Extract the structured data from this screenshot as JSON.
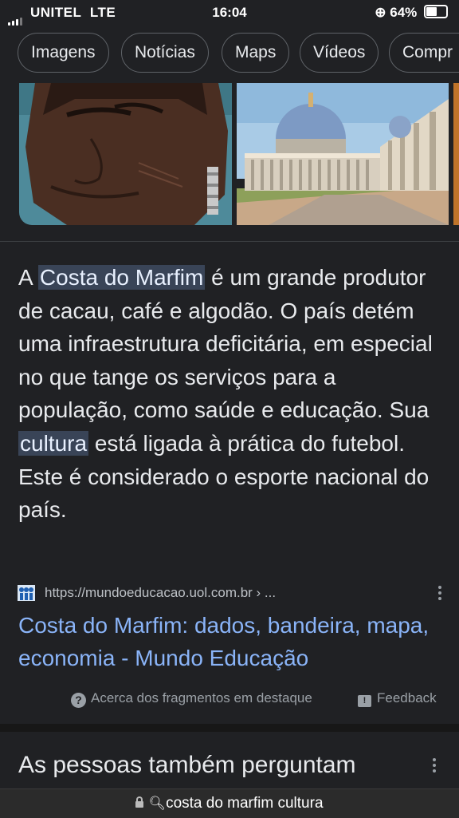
{
  "status_bar": {
    "carrier": "UNITEL",
    "network": "LTE",
    "time": "16:04",
    "battery": "64%",
    "battery_level": 0.64
  },
  "chips": [
    "Imagens",
    "Notícias",
    "Maps",
    "Vídeos",
    "Compr"
  ],
  "snippet": {
    "pre": "A ",
    "highlight1": "Costa do Marfim",
    "mid": " é um grande produtor de cacau, café e algodão. O país detém uma infraestrutura deficitária, em especial no que tange os serviços para a população, como saúde e educação. Sua ",
    "highlight2": "cultura",
    "post": " está ligada à prática do futebol. Este é considerado o esporte nacional do país."
  },
  "source": {
    "url": "https://mundoeducacao.uol.com.br › ...",
    "title": "Costa do Marfim: dados, bandeira, mapa, economia - Mundo Educação"
  },
  "footer": {
    "about": "Acerca dos fragmentos em destaque",
    "feedback": "Feedback"
  },
  "paa_heading": "As pessoas também perguntam",
  "address_bar": "costa do marfim cultura",
  "colors": {
    "background": "#202124",
    "link": "#8ab4f8",
    "highlight": "#394457"
  }
}
